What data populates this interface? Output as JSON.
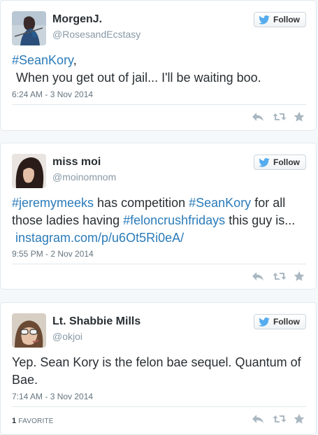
{
  "colors": {
    "link": "#2b7bb9",
    "muted": "#8899a6",
    "action_icon": "#aab8c2",
    "follow_bird": "#55acee"
  },
  "tweets": [
    {
      "name": "MorgenJ.",
      "handle": "@RosesandEcstasy",
      "follow_label": "Follow",
      "text_parts": [
        "#SeanKory",
        ",",
        "When you get out of jail... I'll be waiting boo."
      ],
      "timestamp": "6:24 AM - 3 Nov 2014"
    },
    {
      "name": "miss moi",
      "handle": "@moinomnom",
      "follow_label": "Follow",
      "text_parts": [
        "#jeremymeeks",
        " has competition ",
        "#SeanKory",
        " for all those ladies having ",
        "#feloncrushfridays",
        " this guy is... ",
        "instagram.com/p/u6Ot5Ri0eA/"
      ],
      "timestamp": "9:55 PM - 2 Nov 2014"
    },
    {
      "name": "Lt. Shabbie Mills",
      "handle": "@okjoi",
      "follow_label": "Follow",
      "text_parts": [
        "Yep. Sean Kory is the felon bae sequel. Quantum of Bae."
      ],
      "timestamp": "7:14 AM - 3 Nov 2014",
      "favorites_count": "1",
      "favorites_label": "FAVORITE"
    }
  ],
  "icons": [
    "twitter-bird-icon",
    "reply-icon",
    "retweet-icon",
    "favorite-star-icon"
  ]
}
